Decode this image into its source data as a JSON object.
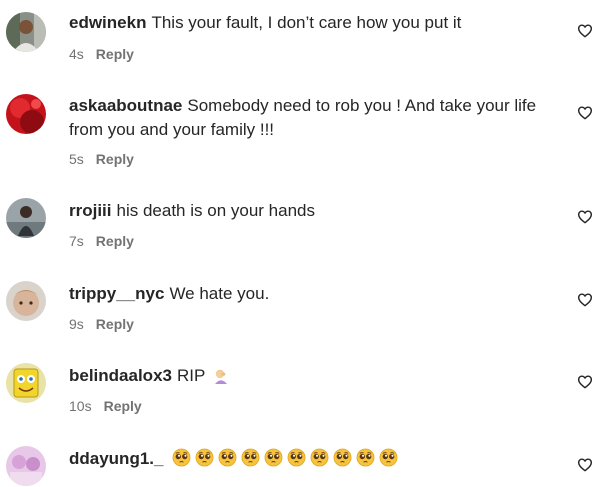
{
  "comments": [
    {
      "username": "edwinekn",
      "text": "This your fault, I don’t care how you put it",
      "time": "4s",
      "reply_label": "Reply",
      "avatar_icon": "user-photo-icon"
    },
    {
      "username": "askaaboutnae",
      "text": "Somebody need to rob you ! And take your life from you and your family !!!",
      "time": "5s",
      "reply_label": "Reply",
      "avatar_icon": "user-photo-icon"
    },
    {
      "username": "rrojiii",
      "text": "his death is on your hands",
      "time": "7s",
      "reply_label": "Reply",
      "avatar_icon": "user-photo-icon"
    },
    {
      "username": "trippy__nyc",
      "text": "We hate you.",
      "time": "9s",
      "reply_label": "Reply",
      "avatar_icon": "user-photo-icon"
    },
    {
      "username": "belindaalox3",
      "text": "RIP",
      "emoji": "person-facepalming-emoji",
      "time": "10s",
      "reply_label": "Reply",
      "avatar_icon": "user-photo-icon"
    },
    {
      "username": "ddayung1._",
      "text": "",
      "emoji": "pleading-face-emoji",
      "emoji_count": 10,
      "time": "",
      "reply_label": "",
      "avatar_icon": "user-photo-icon"
    }
  ],
  "like_icon": "heart-outline-icon",
  "colors": {
    "text": "#262626",
    "secondary": "#737373",
    "background": "#ffffff"
  }
}
